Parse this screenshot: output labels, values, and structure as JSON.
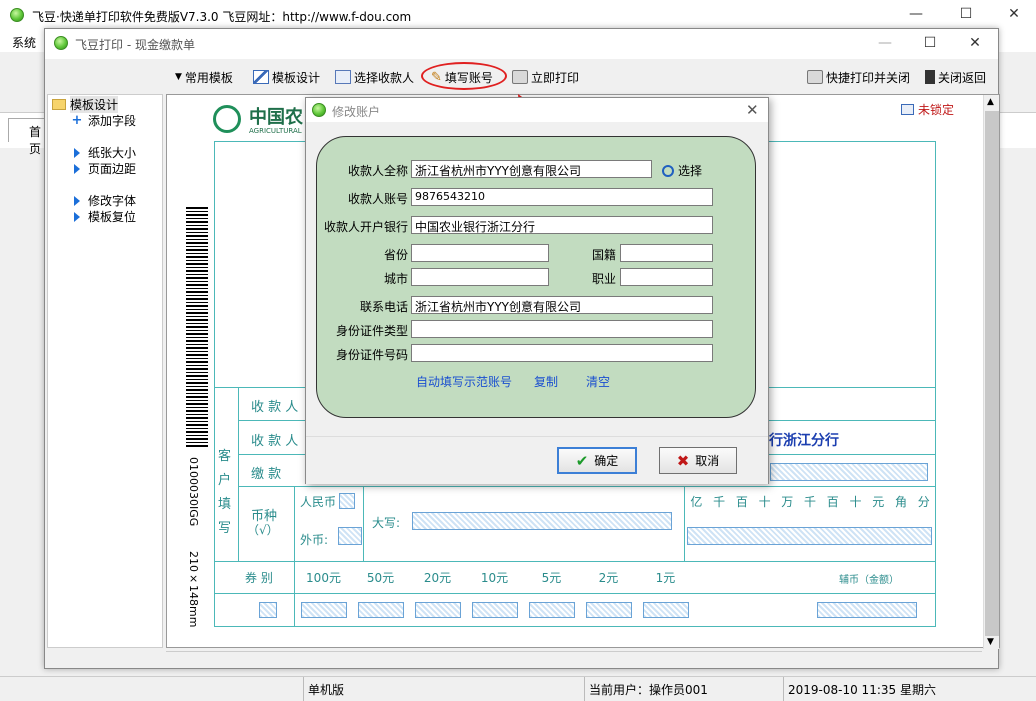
{
  "outer_window": {
    "title": "飞豆·快递单打印软件免费版V7.3.0  飞豆网址：http://www.f-dou.com",
    "menu_system": "系统",
    "tab_home": "首页",
    "controls": {
      "minimize": "—",
      "maximize": "☐",
      "close": "✕"
    }
  },
  "inner_window": {
    "title": "飞豆打印 - 现金缴款单",
    "controls": {
      "minimize": "—",
      "maximize": "☐",
      "close": "✕"
    },
    "toolbar": {
      "common_templates": "常用模板",
      "template_design": "模板设计",
      "select_payee": "选择收款人",
      "fill_account": "填写账号",
      "print_now": "立即打印",
      "quick_print_close": "快捷打印并关闭",
      "close_return": "关闭返回"
    },
    "tree": {
      "root": "模板设计",
      "add_field": "添加字段",
      "paper_size": "纸张大小",
      "page_margin": "页面边距",
      "modify_font": "修改字体",
      "reset_template": "模板复位"
    },
    "canvas": {
      "unlocked": "未锁定",
      "bank_name_partial": "中国农",
      "bank_en_partial": "AGRICULTURAL",
      "vertical_code": "0100030IGG",
      "vertical_size": "210×148mm",
      "customer_fill_label": [
        "客",
        "户",
        "填",
        "写"
      ],
      "payee_row1": "收 款 人",
      "payee_row2": "收 款 人",
      "payer_row": "缴  款",
      "bank_branch_text": "行浙江分行",
      "currency_label": "币种",
      "currency_check": "（√）",
      "rmb": "人民币",
      "foreign": "外币:",
      "capital": "大写:",
      "digits": [
        "亿",
        "千",
        "百",
        "十",
        "万",
        "千",
        "百",
        "十",
        "元",
        "角",
        "分"
      ],
      "coupon_label": "券  别",
      "denominations": [
        "100元",
        "50元",
        "20元",
        "10元",
        "5元",
        "2元",
        "1元"
      ],
      "aux_coin": "辅币（金额）"
    }
  },
  "dialog": {
    "title": "修改账户",
    "close": "✕",
    "fields": {
      "payee_full_name": {
        "label": "收款人全称",
        "value": "浙江省杭州市YYY创意有限公司"
      },
      "payee_account": {
        "label": "收款人账号",
        "value": "9876543210"
      },
      "payee_bank": {
        "label": "收款人开户银行",
        "value": "中国农业银行浙江分行"
      },
      "province": {
        "label": "省份",
        "value": ""
      },
      "nationality": {
        "label": "国籍",
        "value": ""
      },
      "city": {
        "label": "城市",
        "value": ""
      },
      "occupation": {
        "label": "职业",
        "value": ""
      },
      "phone": {
        "label": "联系电话",
        "value": "浙江省杭州市YYY创意有限公司"
      },
      "id_type": {
        "label": "身份证件类型",
        "value": ""
      },
      "id_number": {
        "label": "身份证件号码",
        "value": ""
      }
    },
    "select_label": "选择",
    "links": {
      "autofill": "自动填写示范账号",
      "copy": "复制",
      "clear": "清空"
    },
    "ok": "确定",
    "cancel": "取消"
  },
  "statusbar": {
    "mode": "单机版",
    "current_user": "当前用户：操作员001",
    "datetime": "2019-08-10 11:35 星期六"
  },
  "colors": {
    "dialog_panel": "#c2dcc0",
    "form_lines": "#4cb8b8",
    "annotation": "#e02020",
    "link": "#1a4fd0",
    "bank_branch_text": "#1c3fb0"
  }
}
